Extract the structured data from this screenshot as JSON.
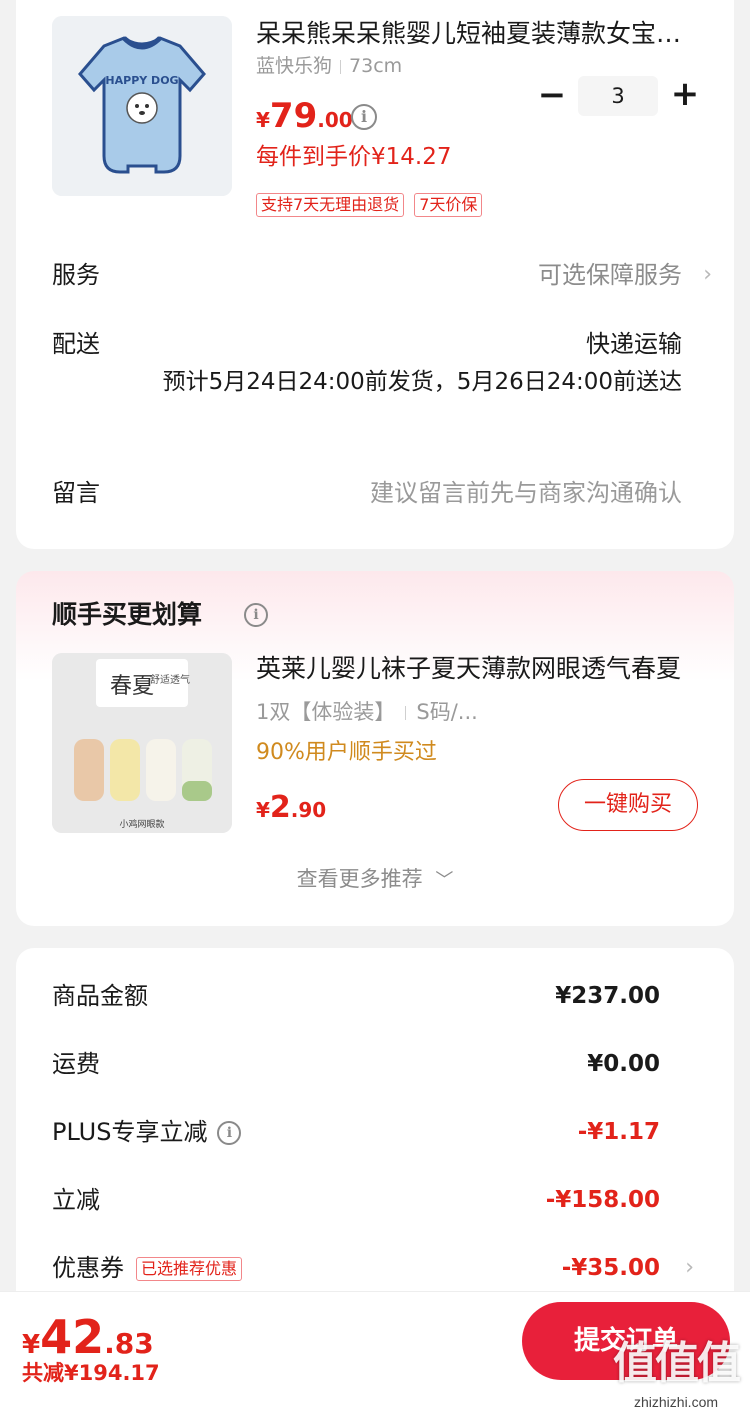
{
  "product": {
    "title": "呆呆熊呆呆熊婴儿短袖夏装薄款女宝宝哈衣",
    "sku_color": "蓝快乐狗",
    "sku_size": "73cm",
    "price_yen": "¥",
    "price_int": "79",
    "price_dec": ".00",
    "unit_price": "每件到手价¥14.27",
    "tags": [
      "支持7天无理由退货",
      "7天价保"
    ],
    "quantity": "3",
    "image_text": "HAPPY DOG"
  },
  "rows": {
    "service_label": "服务",
    "service_value": "可选保障服务",
    "delivery_label": "配送",
    "delivery_method": "快递运输",
    "delivery_eta": "预计5月24日24:00前发货，5月26日24:00前送达",
    "note_label": "留言",
    "note_placeholder": "建议留言前先与商家沟通确认"
  },
  "upsell": {
    "title": "顺手买更划算",
    "name": "英莱儿婴儿袜子夏天薄款网眼透气春夏",
    "sku_pack": "1双【体验装】",
    "sku_size": "S码/...",
    "social": "90%用户顺手买过",
    "price_yen": "¥",
    "price_int": "2",
    "price_dec": ".90",
    "buy_label": "一键购买",
    "more_label": "查看更多推荐",
    "image_title": "春夏",
    "image_sub": "舒适透气",
    "image_caption": "小鸡网眼款"
  },
  "summary": {
    "goods_label": "商品金额",
    "goods_value": "¥237.00",
    "shipping_label": "运费",
    "shipping_value": "¥0.00",
    "plus_label": "PLUS专享立减",
    "plus_value": "-¥1.17",
    "discount_label": "立减",
    "discount_value": "-¥158.00",
    "coupon_label": "优惠券",
    "coupon_tag": "已选推荐优惠",
    "coupon_value": "-¥35.00"
  },
  "bottom": {
    "total_yen": "¥",
    "total_int": "42",
    "total_dec": ".83",
    "saved": "共减¥194.17",
    "submit_label": "提交订单"
  },
  "watermark": {
    "brand": "值值值",
    "url": "zhizhizhi.com"
  },
  "colors": {
    "accent_red": "#e2231a",
    "button_red": "#e8203a",
    "social_orange": "#d08a1e"
  }
}
